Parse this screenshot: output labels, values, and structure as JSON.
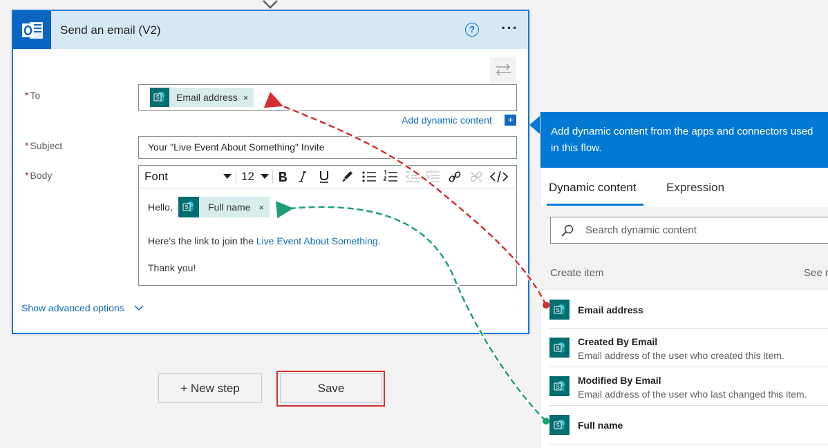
{
  "action_card": {
    "title": "Send an email (V2)",
    "help_glyph": "?",
    "more_glyph": "···",
    "fields": {
      "to": {
        "label": "To",
        "token": "Email address",
        "token_remove": "×"
      },
      "subject": {
        "label": "Subject",
        "value": "Your \"Live Event About Something\" Invite"
      },
      "body": {
        "label": "Body",
        "toolbar": {
          "font": "Font",
          "size": "12"
        },
        "greeting": "Hello,",
        "name_token": "Full name",
        "token_remove": "×",
        "link_prefix": "Here's the link to join the ",
        "link_text": "Live Event About Something",
        "link_suffix": ".",
        "closing": "Thank you!"
      }
    },
    "add_dynamic_content": "Add dynamic content",
    "add_dynamic_plus": "+",
    "required_marker": "*",
    "show_advanced": "Show advanced options"
  },
  "buttons": {
    "new_step": "+ New step",
    "save": "Save"
  },
  "dynamic_panel": {
    "header": "Add dynamic content from the apps and connectors used in this flow.",
    "tabs": [
      "Dynamic content",
      "Expression"
    ],
    "search_placeholder": "Search dynamic content",
    "section": "Create item",
    "see_more": "See more",
    "items": [
      {
        "title": "Email address",
        "description": ""
      },
      {
        "title": "Created By Email",
        "description": "Email address of the user who created this item."
      },
      {
        "title": "Modified By Email",
        "description": "Email address of the user who last changed this item."
      },
      {
        "title": "Full name",
        "description": ""
      }
    ]
  },
  "icon_glyph": "S",
  "colors": {
    "accent": "#0078d4",
    "sharepoint": "#036c70",
    "token_bg": "#d8eceb",
    "annotation_red": "#d32f2f",
    "annotation_green": "#1f9e74"
  }
}
